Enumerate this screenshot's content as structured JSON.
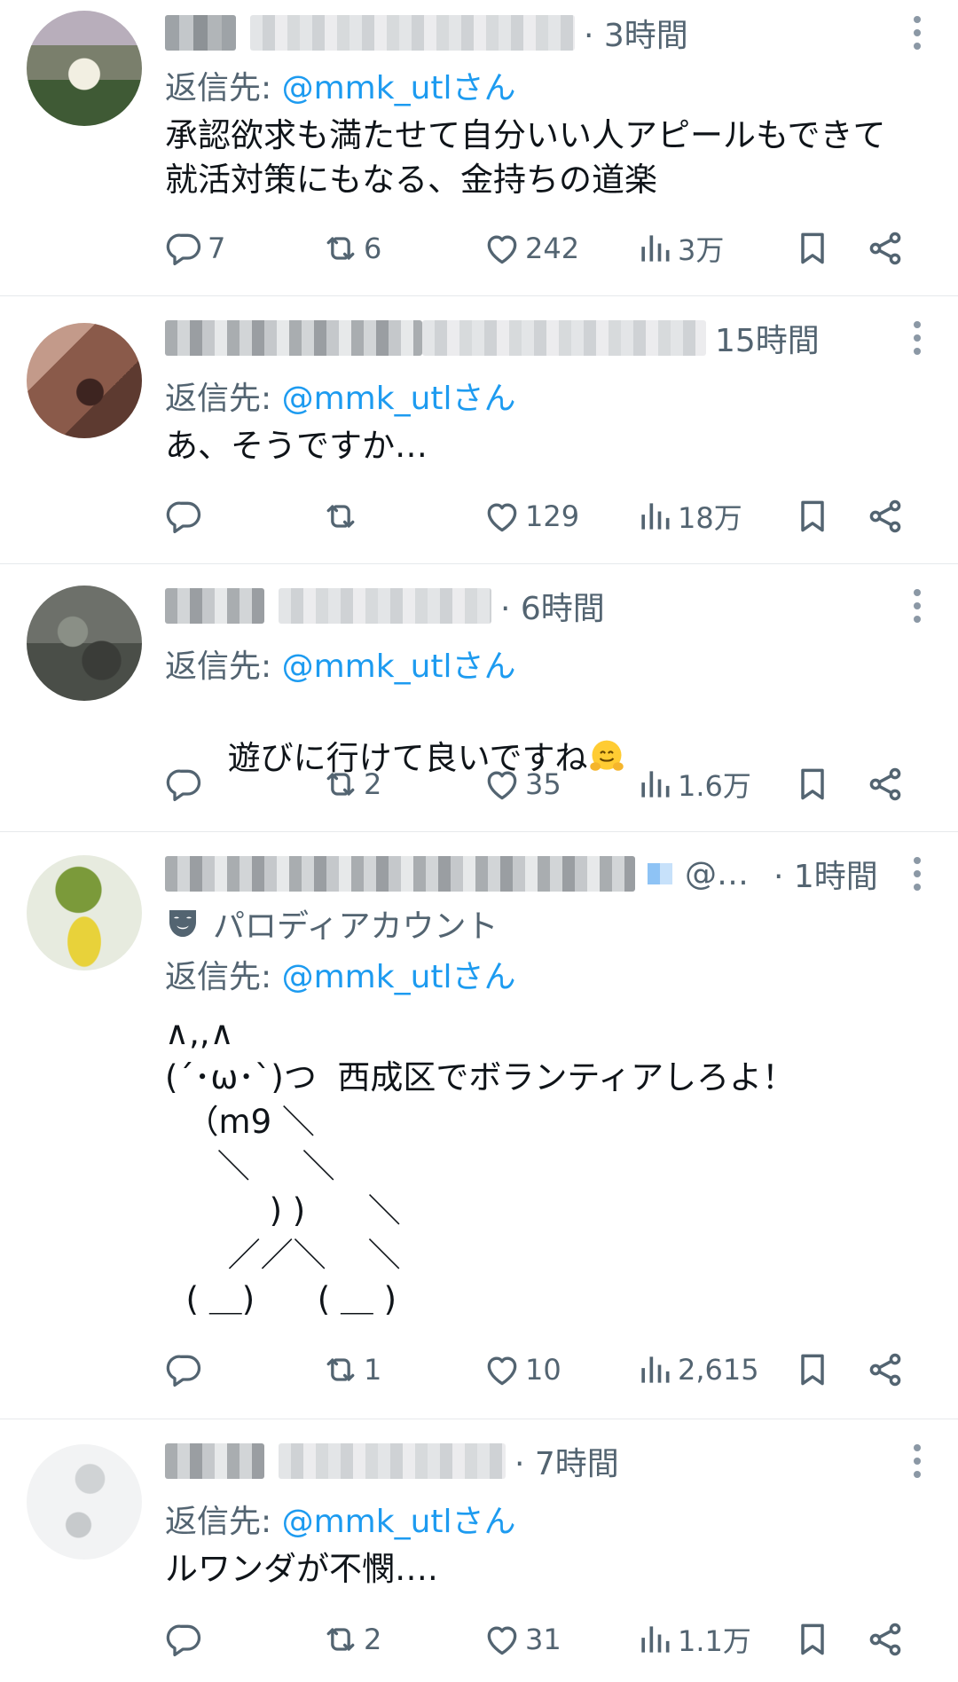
{
  "colors": {
    "accent": "#1d9bf0",
    "secondary": "#536471",
    "text": "#0f1419",
    "divider": "#e6e9ec"
  },
  "tweets": [
    {
      "time": "· 3時間",
      "reply_prefix": "返信先: ",
      "reply_handle": "@mmk_utlさん",
      "body": "承認欲求も満たせて自分いい人アピールもできて\n就活対策にもなる、金持ちの道楽",
      "replies": "7",
      "retweets": "6",
      "likes": "242",
      "views": "3万"
    },
    {
      "time": "15時間",
      "reply_prefix": "返信先: ",
      "reply_handle": "@mmk_utlさん",
      "body": "あ、そうですか…",
      "replies": "",
      "retweets": "",
      "likes": "129",
      "views": "18万"
    },
    {
      "time": "· 6時間",
      "reply_prefix": "返信先: ",
      "reply_handle": "@mmk_utlさん",
      "body": "遊びに行けて良いですね",
      "emoji": "hugging-face-emoji",
      "replies": "",
      "retweets": "2",
      "likes": "35",
      "views": "1.6万"
    },
    {
      "handle_trunc": "@…",
      "time": "· 1時間",
      "parody_label": "パロディアカウント",
      "parody_icon": "theater-mask-icon",
      "reply_prefix": "返信先: ",
      "reply_handle": "@mmk_utlさん",
      "body": "∧,,∧\n(´･ω･`)つ  西成区でボランティアしろよ！\n  （m9 ＼\n     ＼     ＼\n          ) )      ＼\n      ／／＼    ＼\n  ( ＿)      ( ＿ )",
      "replies": "",
      "retweets": "1",
      "likes": "10",
      "views": "2,615"
    },
    {
      "time": "· 7時間",
      "reply_prefix": "返信先: ",
      "reply_handle": "@mmk_utlさん",
      "body": "ルワンダが不憫….",
      "replies": "",
      "retweets": "2",
      "likes": "31",
      "views": "1.1万"
    }
  ]
}
